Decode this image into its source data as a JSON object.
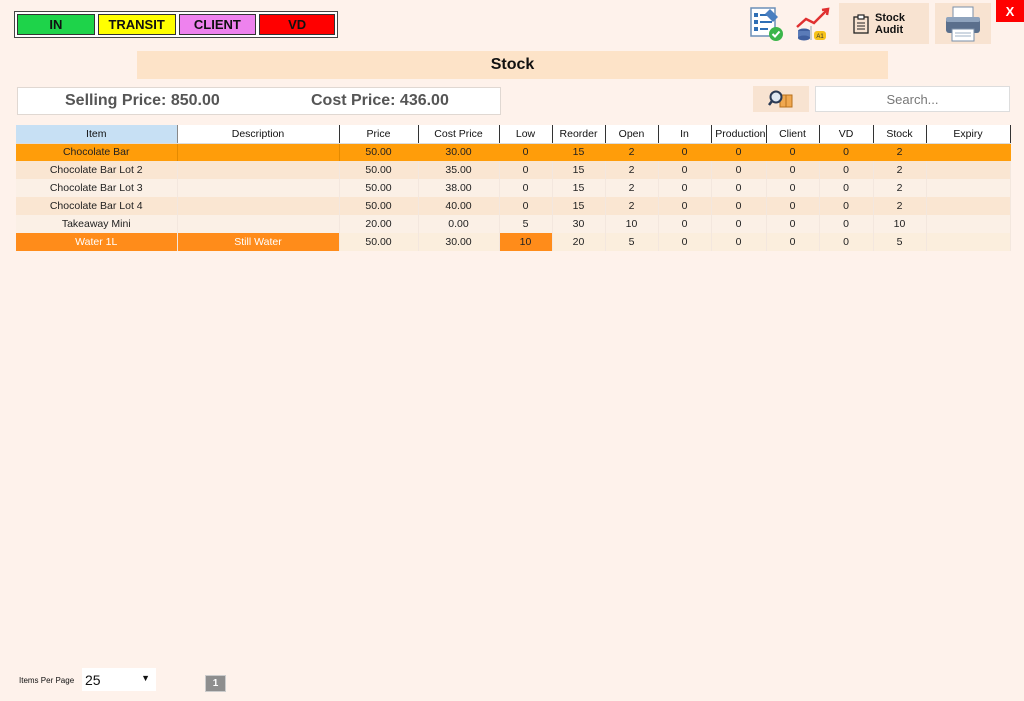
{
  "legend": {
    "in": "IN",
    "transit": "TRANSIT",
    "client": "CLIENT",
    "vd": "VD",
    "colors": {
      "in": "#1ed34a",
      "transit": "#ffff00",
      "client": "#ee82ee",
      "vd": "#ff0000"
    }
  },
  "toolbar": {
    "edit_icon": "checklist-edit-icon",
    "chart_icon": "stock-chart-icon",
    "audit_label_line1": "Stock",
    "audit_label_line2": "Audit",
    "print_icon": "printer-icon",
    "close_label": "X"
  },
  "title": "Stock",
  "summary": {
    "selling_price": "Selling Price: 850.00",
    "cost_price": "Cost Price: 436.00"
  },
  "search": {
    "placeholder": "Search...",
    "value": ""
  },
  "table": {
    "columns": [
      "Item",
      "Description",
      "Price",
      "Cost Price",
      "Low",
      "Reorder",
      "Open",
      "In",
      "Production",
      "Client",
      "VD",
      "Stock",
      "Expiry"
    ],
    "rows": [
      [
        "Chocolate Bar",
        "",
        "50.00",
        "30.00",
        "0",
        "15",
        "2",
        "0",
        "0",
        "0",
        "0",
        "2",
        ""
      ],
      [
        "Chocolate Bar Lot 2",
        "",
        "50.00",
        "35.00",
        "0",
        "15",
        "2",
        "0",
        "0",
        "0",
        "0",
        "2",
        ""
      ],
      [
        "Chocolate Bar Lot 3",
        "",
        "50.00",
        "38.00",
        "0",
        "15",
        "2",
        "0",
        "0",
        "0",
        "0",
        "2",
        ""
      ],
      [
        "Chocolate Bar Lot 4",
        "",
        "50.00",
        "40.00",
        "0",
        "15",
        "2",
        "0",
        "0",
        "0",
        "0",
        "2",
        ""
      ],
      [
        "Takeaway Mini",
        "",
        "20.00",
        "0.00",
        "5",
        "30",
        "10",
        "0",
        "0",
        "0",
        "0",
        "10",
        ""
      ],
      [
        "Water 1L",
        "Still Water",
        "50.00",
        "30.00",
        "10",
        "20",
        "5",
        "0",
        "0",
        "0",
        "0",
        "5",
        ""
      ]
    ]
  },
  "footer": {
    "items_per_page_label": "Items Per Page",
    "items_per_page_value": "25",
    "current_page": "1"
  }
}
